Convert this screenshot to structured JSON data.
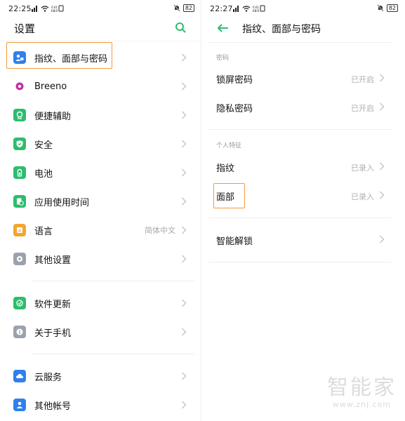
{
  "left": {
    "status": {
      "time": "22:25",
      "battery": "82"
    },
    "title": "设置",
    "items": [
      {
        "label": "指纹、面部与密码",
        "value": ""
      },
      {
        "label": "Breeno",
        "value": ""
      },
      {
        "label": "便捷辅助",
        "value": ""
      },
      {
        "label": "安全",
        "value": ""
      },
      {
        "label": "电池",
        "value": ""
      },
      {
        "label": "应用使用时间",
        "value": ""
      },
      {
        "label": "语言",
        "value": "简体中文"
      },
      {
        "label": "其他设置",
        "value": ""
      },
      {
        "label": "软件更新",
        "value": ""
      },
      {
        "label": "关于手机",
        "value": ""
      },
      {
        "label": "云服务",
        "value": ""
      },
      {
        "label": "其他帐号",
        "value": ""
      }
    ]
  },
  "right": {
    "status": {
      "time": "22:27",
      "battery": "82"
    },
    "title": "指纹、面部与密码",
    "section_password": "密码",
    "section_personal": "个人特征",
    "items": [
      {
        "label": "锁屏密码",
        "value": "已开启"
      },
      {
        "label": "隐私密码",
        "value": "已开启"
      },
      {
        "label": "指纹",
        "value": "已录入"
      },
      {
        "label": "面部",
        "value": "已录入"
      },
      {
        "label": "智能解锁",
        "value": ""
      }
    ]
  },
  "watermark": {
    "brand": "智能家",
    "url": "www.znj.com"
  },
  "colors": {
    "accent": "#2dbd6e",
    "highlight": "#f39a3c"
  }
}
